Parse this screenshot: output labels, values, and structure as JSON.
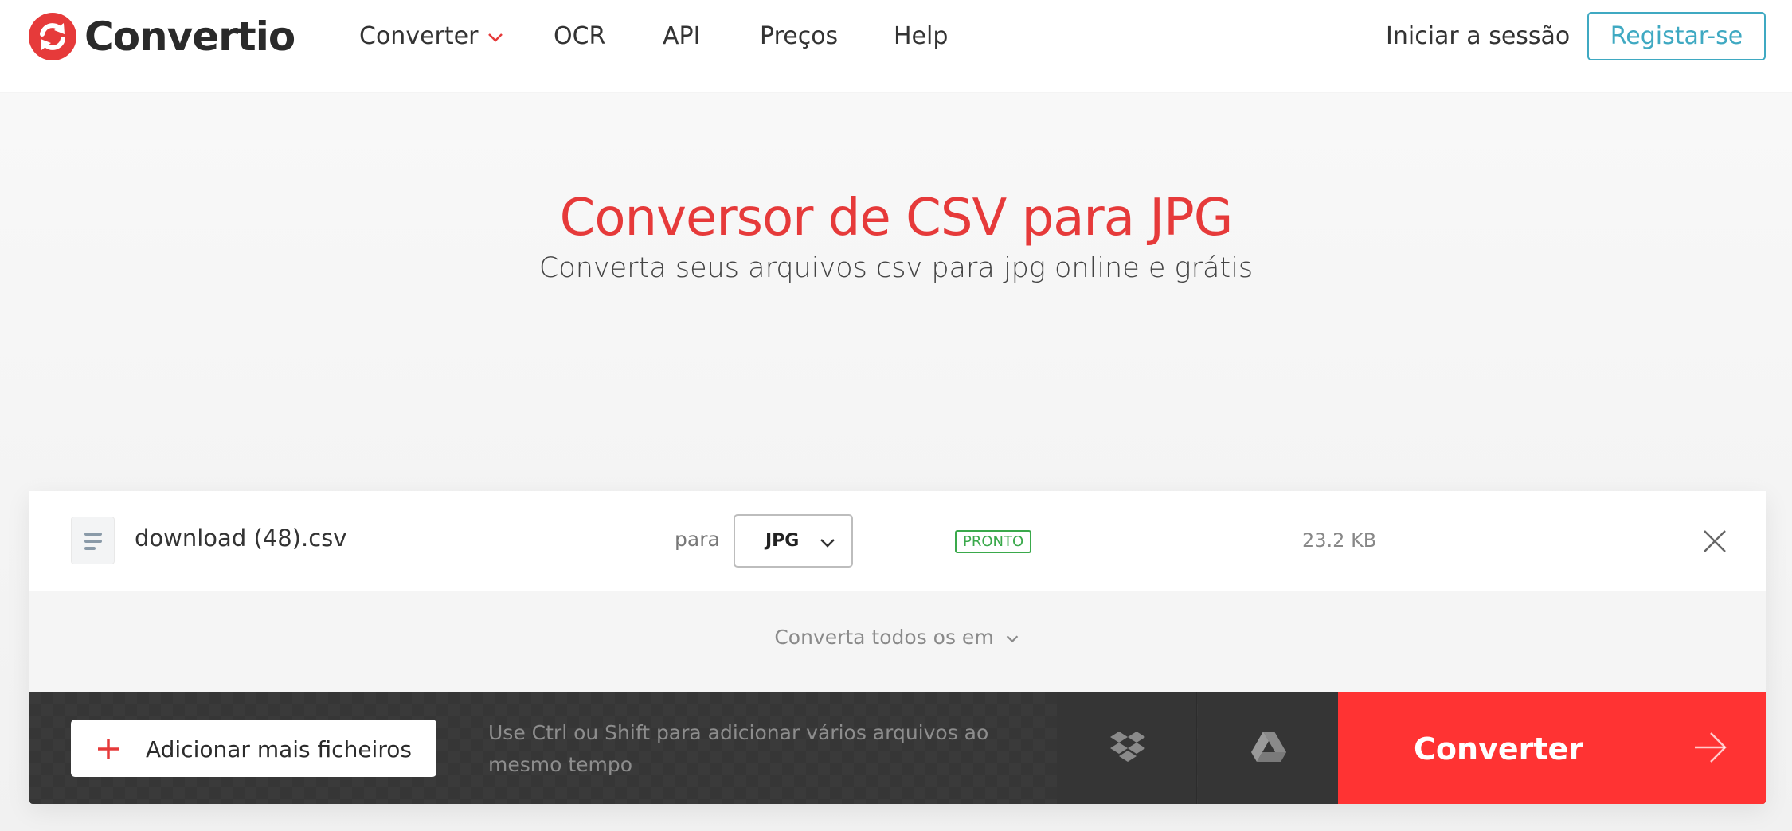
{
  "brand": {
    "name": "Convertio",
    "logo_color": "#e63a3a"
  },
  "nav": {
    "items": [
      {
        "label": "Converter"
      },
      {
        "label": "OCR"
      },
      {
        "label": "API"
      },
      {
        "label": "Preços"
      },
      {
        "label": "Help"
      }
    ],
    "login_label": "Iniciar a sessão",
    "register_label": "Registar-se"
  },
  "hero": {
    "title": "Conversor de CSV para JPG",
    "subtitle": "Converta seus arquivos csv para jpg online e grátis"
  },
  "file": {
    "name": "download (48).csv",
    "to_label": "para",
    "target_format": "JPG",
    "status": "PRONTO",
    "size": "23.2 KB"
  },
  "convert_all_label": "Converta todos os em",
  "actions": {
    "add_files_label": "Adicionar mais ficheiros",
    "hint": "Use Ctrl ou Shift para adicionar vários arquivos ao mesmo tempo",
    "convert_label": "Converter"
  },
  "colors": {
    "accent_red": "#ff3333",
    "title_red": "#e63a3a",
    "register_blue": "#3fa9c2",
    "status_green": "#3aa94b"
  }
}
